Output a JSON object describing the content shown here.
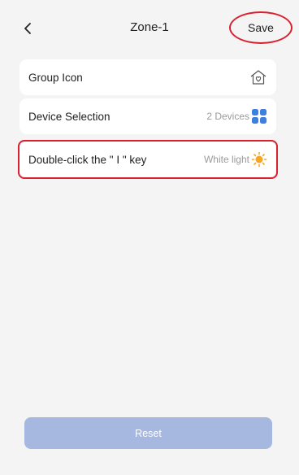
{
  "header": {
    "title": "Zone-1",
    "save_label": "Save"
  },
  "rows": [
    {
      "label": "Group Icon",
      "icon": "home-heart-icon"
    },
    {
      "label": "Device Selection",
      "value": "2 Devices",
      "icon": "grid-icon"
    },
    {
      "label": "Double-click the \" I \" key",
      "value": "White light",
      "icon": "sun-icon"
    }
  ],
  "footer": {
    "reset_label": "Reset"
  },
  "colors": {
    "background": "#f4f4f4",
    "card": "#ffffff",
    "highlight": "#d9202f",
    "grid_icon": "#3d7fe0",
    "sun_icon": "#f5a623",
    "reset_button": "#a7b8e0"
  }
}
